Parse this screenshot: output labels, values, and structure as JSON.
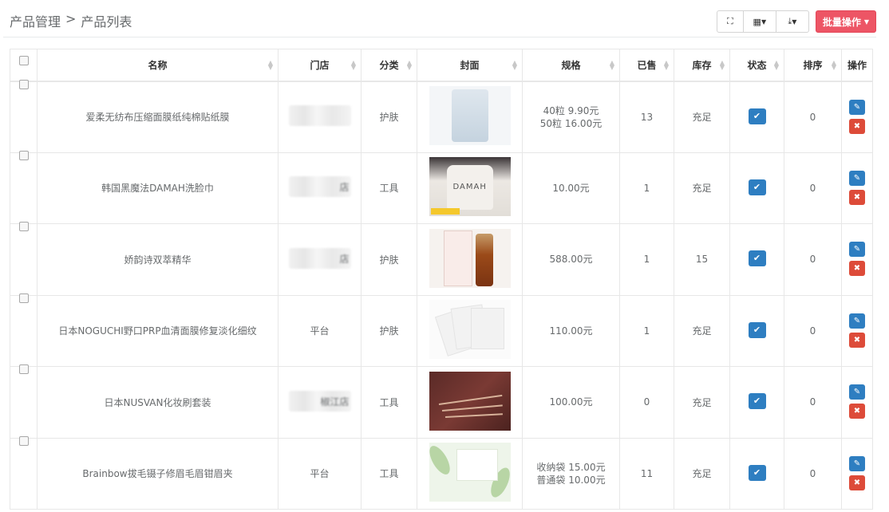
{
  "breadcrumb": {
    "parent": "产品管理",
    "separator": ">",
    "current": "产品列表"
  },
  "toolbar": {
    "fullscreen_icon": "fullscreen-icon",
    "columns_icon": "grid-icon",
    "export_icon": "download-icon",
    "batch_label": "批量操作"
  },
  "table": {
    "headers": {
      "name": "名称",
      "store": "门店",
      "category": "分类",
      "cover": "封面",
      "spec": "规格",
      "sold": "已售",
      "stock": "库存",
      "status": "状态",
      "sort": "排序",
      "ops": "操作"
    },
    "rows": [
      {
        "name": "爱柔无纺布压缩面膜纸纯棉贴纸膜",
        "store": "",
        "store_suffix": "",
        "store_blurred": true,
        "category": "护肤",
        "spec": [
          "40粒 9.90元",
          "50粒 16.00元"
        ],
        "sold": "13",
        "stock": "充足",
        "sort": "0"
      },
      {
        "name": "韩国黑魔法DAMAH洗脸巾",
        "store": "",
        "store_suffix": "店",
        "store_blurred": true,
        "category": "工具",
        "spec": [
          "10.00元"
        ],
        "sold": "1",
        "stock": "充足",
        "sort": "0"
      },
      {
        "name": "娇韵诗双萃精华",
        "store": "",
        "store_suffix": "店",
        "store_blurred": true,
        "category": "护肤",
        "spec": [
          "588.00元"
        ],
        "sold": "1",
        "stock": "15",
        "sort": "0"
      },
      {
        "name": "日本NOGUCHI野口PRP血清面膜修复淡化细纹",
        "store": "平台",
        "store_suffix": "",
        "store_blurred": false,
        "category": "护肤",
        "spec": [
          "110.00元"
        ],
        "sold": "1",
        "stock": "充足",
        "sort": "0"
      },
      {
        "name": "日本NUSVAN化妆刷套装",
        "store": "",
        "store_suffix": "椒江店",
        "store_blurred": true,
        "category": "工具",
        "spec": [
          "100.00元"
        ],
        "sold": "0",
        "stock": "充足",
        "sort": "0"
      },
      {
        "name": "Brainbow拔毛镊子修眉毛眉钳眉夹",
        "store": "平台",
        "store_suffix": "",
        "store_blurred": false,
        "category": "工具",
        "spec": [
          "收纳袋 15.00元",
          "普通袋 10.00元"
        ],
        "sold": "11",
        "stock": "充足",
        "sort": "0"
      }
    ]
  },
  "cover_words": {
    "row2": "DAMAH"
  },
  "colors": {
    "batch_red": "#ed5565",
    "edit_blue": "#2e7ec1",
    "delete_red": "#dd4b39"
  }
}
